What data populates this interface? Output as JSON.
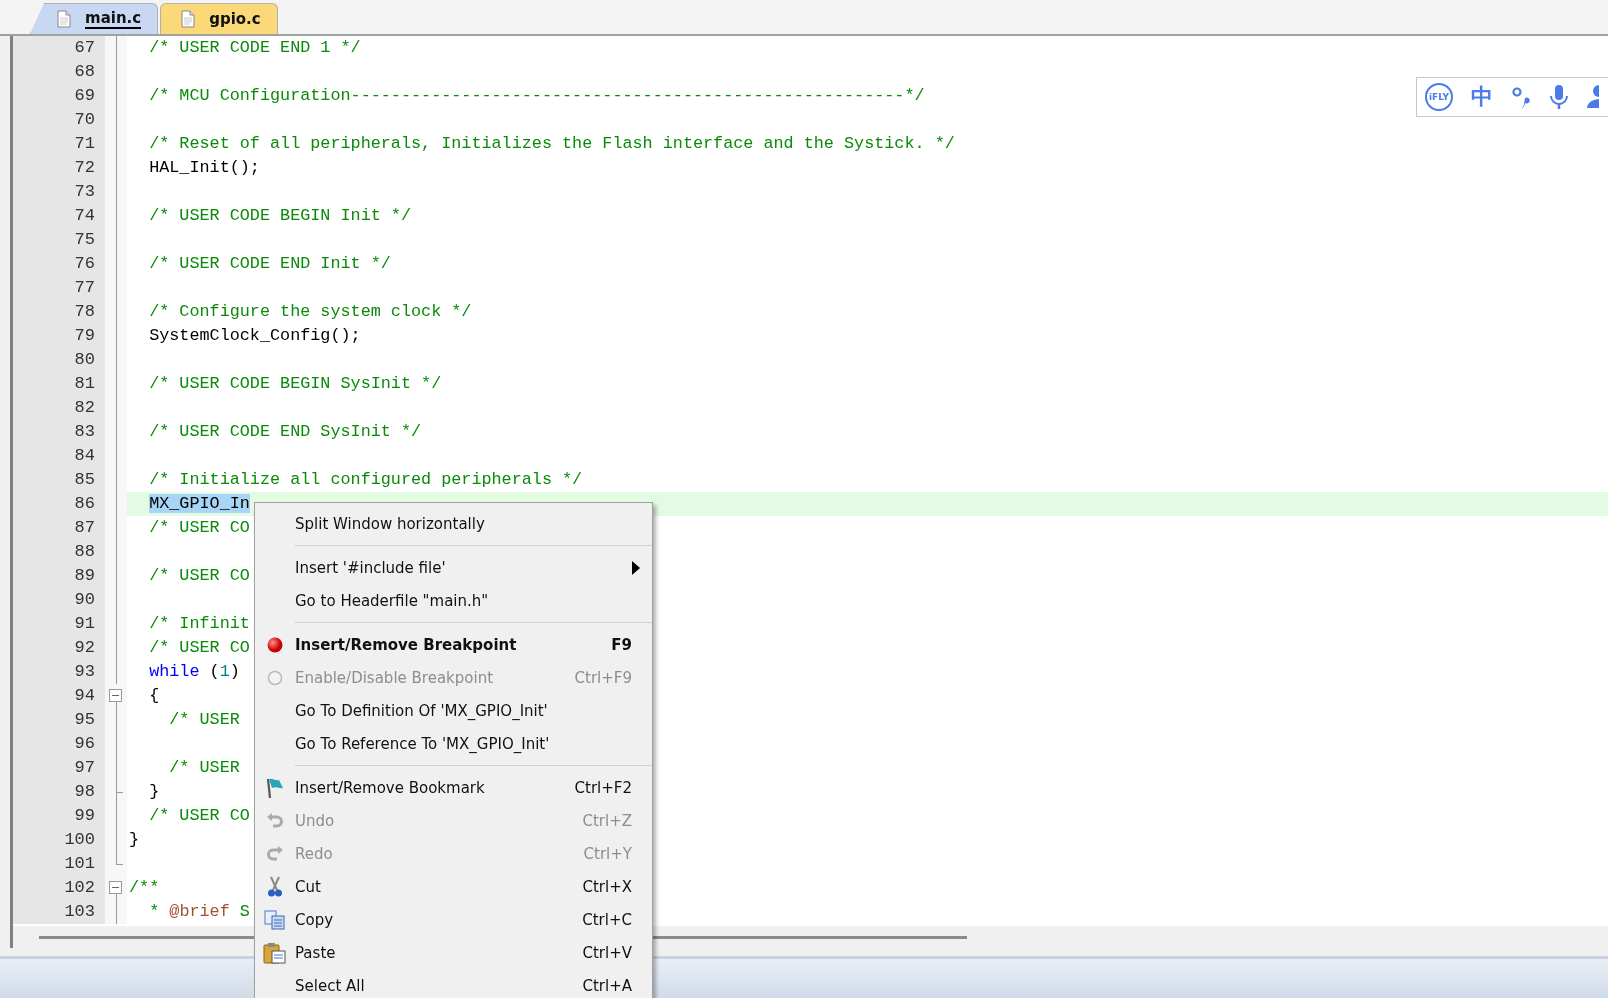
{
  "tabs": [
    {
      "label": "main.c",
      "selected": true
    },
    {
      "label": "gpio.c",
      "selected": false
    }
  ],
  "editor": {
    "lines": [
      {
        "number": "67",
        "kind": "body",
        "current": false,
        "segments": [
          {
            "kind": "comment",
            "selected": false,
            "text": "  /* USER CODE END 1 */"
          }
        ]
      },
      {
        "number": "68",
        "kind": "body",
        "current": false
      },
      {
        "number": "69",
        "kind": "body",
        "current": false,
        "segments": [
          {
            "kind": "comment",
            "selected": false,
            "text": "  /* MCU Configuration-------------------------------------------------------*/"
          }
        ]
      },
      {
        "number": "70",
        "kind": "body",
        "current": false
      },
      {
        "number": "71",
        "kind": "body",
        "current": false,
        "segments": [
          {
            "kind": "comment",
            "selected": false,
            "text": "  /* Reset of all peripherals, Initializes the Flash interface and the Systick. */"
          }
        ]
      },
      {
        "number": "72",
        "kind": "body",
        "current": false,
        "segments": [
          {
            "kind": "plain",
            "selected": false,
            "text": "  HAL_Init();"
          }
        ]
      },
      {
        "number": "73",
        "kind": "body",
        "current": false
      },
      {
        "number": "74",
        "kind": "body",
        "current": false,
        "segments": [
          {
            "kind": "comment",
            "selected": false,
            "text": "  /* USER CODE BEGIN Init */"
          }
        ]
      },
      {
        "number": "75",
        "kind": "body",
        "current": false
      },
      {
        "number": "76",
        "kind": "body",
        "current": false,
        "segments": [
          {
            "kind": "comment",
            "selected": false,
            "text": "  /* USER CODE END Init */"
          }
        ]
      },
      {
        "number": "77",
        "kind": "body",
        "current": false
      },
      {
        "number": "78",
        "kind": "body",
        "current": false,
        "segments": [
          {
            "kind": "comment",
            "selected": false,
            "text": "  /* Configure the system clock */"
          }
        ]
      },
      {
        "number": "79",
        "kind": "body",
        "current": false,
        "segments": [
          {
            "kind": "plain",
            "selected": false,
            "text": "  SystemClock_Config();"
          }
        ]
      },
      {
        "number": "80",
        "kind": "body",
        "current": false
      },
      {
        "number": "81",
        "kind": "body",
        "current": false,
        "segments": [
          {
            "kind": "comment",
            "selected": false,
            "text": "  /* USER CODE BEGIN SysInit */"
          }
        ]
      },
      {
        "number": "82",
        "kind": "body",
        "current": false
      },
      {
        "number": "83",
        "kind": "body",
        "current": false,
        "segments": [
          {
            "kind": "comment",
            "selected": false,
            "text": "  /* USER CODE END SysInit */"
          }
        ]
      },
      {
        "number": "84",
        "kind": "body",
        "current": false
      },
      {
        "number": "85",
        "kind": "body",
        "current": false,
        "segments": [
          {
            "kind": "comment",
            "selected": false,
            "text": "  /* Initialize all configured peripherals */"
          }
        ]
      },
      {
        "number": "86",
        "kind": "body",
        "current": true,
        "segments": [
          {
            "kind": "plain",
            "selected": true,
            "text": "  MX_GPIO_In"
          }
        ]
      },
      {
        "number": "87",
        "kind": "body",
        "current": false,
        "segments": [
          {
            "kind": "comment",
            "selected": false,
            "text": "  /* USER CO"
          }
        ]
      },
      {
        "number": "88",
        "kind": "body",
        "current": false
      },
      {
        "number": "89",
        "kind": "body",
        "current": false,
        "segments": [
          {
            "kind": "comment",
            "selected": false,
            "text": "  /* USER CO"
          }
        ]
      },
      {
        "number": "90",
        "kind": "body",
        "current": false
      },
      {
        "number": "91",
        "kind": "body",
        "current": false,
        "segments": [
          {
            "kind": "comment",
            "selected": false,
            "text": "  /* Infinit"
          }
        ]
      },
      {
        "number": "92",
        "kind": "body",
        "current": false,
        "segments": [
          {
            "kind": "comment",
            "selected": false,
            "text": "  /* USER CO"
          }
        ]
      },
      {
        "number": "93",
        "kind": "body",
        "current": false,
        "segments": [
          {
            "kind": "keyword",
            "selected": false,
            "text": "  while"
          },
          {
            "kind": "plain",
            "selected": false,
            "text": " ("
          },
          {
            "kind": "number",
            "selected": false,
            "text": "1"
          },
          {
            "kind": "plain",
            "selected": false,
            "text": ")"
          }
        ]
      },
      {
        "number": "94",
        "kind": "foldstart",
        "current": false,
        "segments": [
          {
            "kind": "plain",
            "selected": false,
            "text": "  {"
          }
        ]
      },
      {
        "number": "95",
        "kind": "body",
        "current": false,
        "segments": [
          {
            "kind": "comment",
            "selected": false,
            "text": "    /* USER"
          }
        ]
      },
      {
        "number": "96",
        "kind": "body",
        "current": false
      },
      {
        "number": "97",
        "kind": "body",
        "current": false,
        "segments": [
          {
            "kind": "comment",
            "selected": false,
            "text": "    /* USER"
          }
        ]
      },
      {
        "number": "98",
        "kind": "branchend",
        "current": false,
        "segments": [
          {
            "kind": "plain",
            "selected": false,
            "text": "  }"
          }
        ]
      },
      {
        "number": "99",
        "kind": "body",
        "current": false,
        "segments": [
          {
            "kind": "comment",
            "selected": false,
            "text": "  /* USER CO"
          }
        ]
      },
      {
        "number": "100",
        "kind": "body",
        "current": false,
        "segments": [
          {
            "kind": "plain",
            "selected": false,
            "text": "}"
          }
        ]
      },
      {
        "number": "101",
        "kind": "blockend",
        "current": false
      },
      {
        "number": "102",
        "kind": "foldstart",
        "current": false,
        "segments": [
          {
            "kind": "comment",
            "selected": false,
            "text": "/**"
          }
        ]
      },
      {
        "number": "103",
        "kind": "body",
        "current": false,
        "segments": [
          {
            "kind": "comment",
            "selected": false,
            "text": "  * "
          },
          {
            "kind": "doctag",
            "selected": false,
            "text": "@brief"
          },
          {
            "kind": "comment",
            "selected": false,
            "text": " S"
          }
        ]
      }
    ]
  },
  "ime_toolbar": {
    "logo": "iFLY",
    "mode": "中"
  },
  "context_menu": [
    {
      "kind": "plain",
      "label": "Split Window horizontally",
      "disabled": false,
      "default": false,
      "submenu": false
    },
    {
      "kind": "separator"
    },
    {
      "kind": "plain",
      "label": "Insert '#include file'",
      "disabled": false,
      "default": false,
      "submenu": true
    },
    {
      "kind": "plain",
      "label": "Go to Headerfile \"main.h\"",
      "disabled": false,
      "default": false,
      "submenu": false
    },
    {
      "kind": "separator"
    },
    {
      "kind": "breakpoint",
      "label": "Insert/Remove Breakpoint",
      "shortcut": "F9",
      "disabled": false,
      "default": true,
      "submenu": false
    },
    {
      "kind": "toggle",
      "label": "Enable/Disable Breakpoint",
      "shortcut": "Ctrl+F9",
      "disabled": true,
      "default": false,
      "submenu": false
    },
    {
      "kind": "plain",
      "label": "Go To Definition Of 'MX_GPIO_Init'",
      "disabled": false,
      "default": false,
      "submenu": false
    },
    {
      "kind": "plain",
      "label": "Go To Reference To 'MX_GPIO_Init'",
      "disabled": false,
      "default": false,
      "submenu": false
    },
    {
      "kind": "separator"
    },
    {
      "kind": "bookmark",
      "label": "Insert/Remove Bookmark",
      "shortcut": "Ctrl+F2",
      "disabled": false,
      "default": false,
      "submenu": false
    },
    {
      "kind": "undo",
      "label": "Undo",
      "shortcut": "Ctrl+Z",
      "disabled": true,
      "default": false,
      "submenu": false
    },
    {
      "kind": "redo",
      "label": "Redo",
      "shortcut": "Ctrl+Y",
      "disabled": true,
      "default": false,
      "submenu": false
    },
    {
      "kind": "cut",
      "label": "Cut",
      "shortcut": "Ctrl+X",
      "disabled": false,
      "default": false,
      "submenu": false
    },
    {
      "kind": "copy",
      "label": "Copy",
      "shortcut": "Ctrl+C",
      "disabled": false,
      "default": false,
      "submenu": false
    },
    {
      "kind": "paste",
      "label": "Paste",
      "shortcut": "Ctrl+V",
      "disabled": false,
      "default": false,
      "submenu": false
    },
    {
      "kind": "plain",
      "label": "Select All",
      "shortcut": "Ctrl+A",
      "disabled": false,
      "default": false,
      "submenu": false
    }
  ]
}
